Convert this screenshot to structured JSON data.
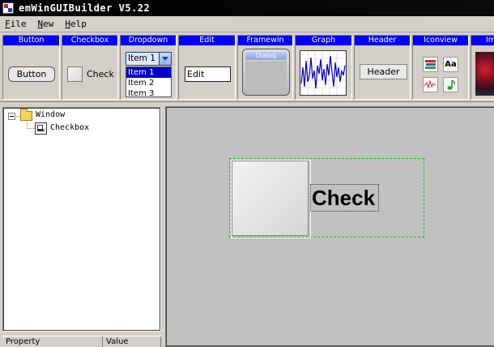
{
  "titlebar": {
    "title": "emWinGUIBuilder V5.22"
  },
  "menubar": {
    "items": [
      {
        "label_first": "F",
        "label_rest": "ile"
      },
      {
        "label_first": "N",
        "label_rest": "ew"
      },
      {
        "label_first": "H",
        "label_rest": "elp"
      }
    ]
  },
  "palette": {
    "button": {
      "caption": "Button",
      "label": "Button"
    },
    "checkbox": {
      "caption": "Checkbox",
      "label": "Check"
    },
    "dropdown": {
      "caption": "Dropdown",
      "selected": "Item 1",
      "options": [
        "Item 1",
        "Item 2",
        "Item 3"
      ]
    },
    "edit": {
      "caption": "Edit",
      "value": "Edit"
    },
    "framewin": {
      "caption": "Framewin",
      "title": "Dialog"
    },
    "graph": {
      "caption": "Graph"
    },
    "header": {
      "caption": "Header",
      "label": "Header"
    },
    "iconview": {
      "caption": "Iconview",
      "icon_text": "Aa"
    },
    "image": {
      "caption": "Im"
    }
  },
  "tree": {
    "root": "Window",
    "child": "Checkbox"
  },
  "properties": {
    "col_property": "Property",
    "col_value": "Value"
  },
  "canvas": {
    "checkbox_text": "Check"
  },
  "colors": {
    "palette_caption_bg": "#0000ff",
    "selection_dash": "#20c020",
    "canvas_bg": "#c0c0c0"
  }
}
